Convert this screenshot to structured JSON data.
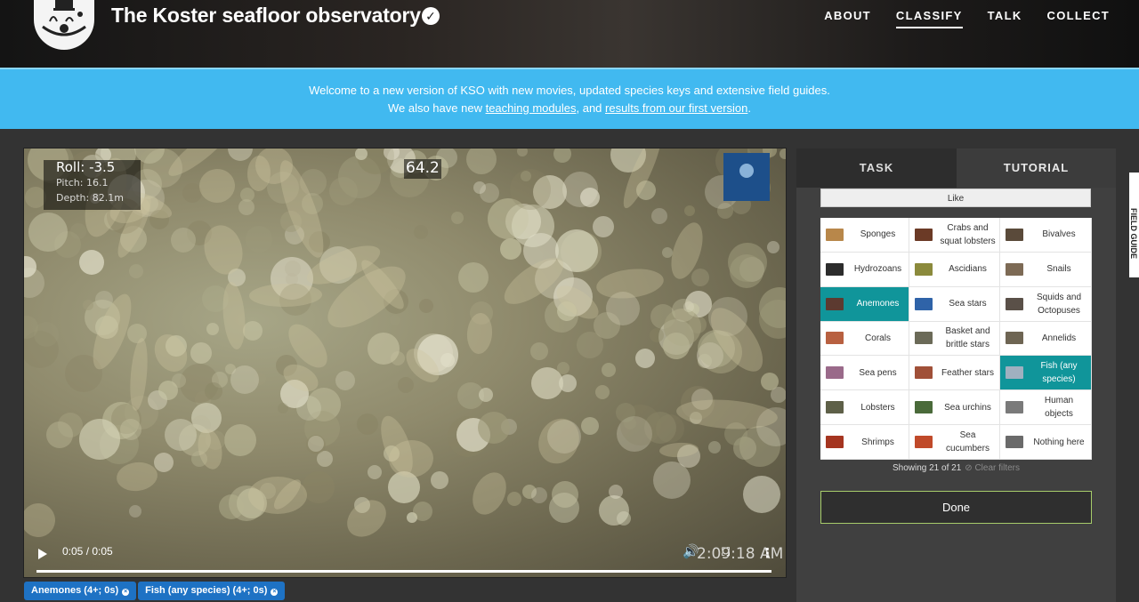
{
  "header": {
    "title": "The Koster seafloor observatory",
    "verified_icon": "check-badge-icon",
    "nav": [
      "ABOUT",
      "CLASSIFY",
      "TALK",
      "COLLECT"
    ],
    "active_nav": "CLASSIFY"
  },
  "banner": {
    "line1": "Welcome to a new version of KSO with new movies, updated species keys and extensive field guides.",
    "line2_prefix": "We also have new ",
    "link1": "teaching modules",
    "line2_mid": ", and ",
    "link2": "results from our first version",
    "line2_suffix": "."
  },
  "video": {
    "overlay_roll": "Roll: -3.5",
    "overlay_pitch": "Pitch: 16.1",
    "overlay_depth": "Depth: 82.1m",
    "overlay_heading": "64.2",
    "time": "0:05 / 0:05",
    "clock": "2:09:18 AM",
    "progress": 1.0
  },
  "tags": [
    {
      "label": "Anemones (4+; 0s)"
    },
    {
      "label": "Fish (any species) (4+; 0s)"
    }
  ],
  "panel": {
    "tab_task": "TASK",
    "tab_tutorial": "TUTORIAL",
    "like": "Like",
    "species": [
      {
        "name": "Sponges",
        "color": "#b8874a"
      },
      {
        "name": "Crabs and squat lobsters",
        "color": "#6b3a26"
      },
      {
        "name": "Bivalves",
        "color": "#5a4a3a"
      },
      {
        "name": "Hydrozoans",
        "color": "#2c2c2c"
      },
      {
        "name": "Ascidians",
        "color": "#8b8a3c"
      },
      {
        "name": "Snails",
        "color": "#7d6a55"
      },
      {
        "name": "Anemones",
        "color": "#5c3a30",
        "selected": true
      },
      {
        "name": "Sea stars",
        "color": "#2f63a8"
      },
      {
        "name": "Squids and Octopuses",
        "color": "#5a5048"
      },
      {
        "name": "Corals",
        "color": "#b86040"
      },
      {
        "name": "Basket and brittle stars",
        "color": "#6b6a58"
      },
      {
        "name": "Annelids",
        "color": "#6e6553"
      },
      {
        "name": "Sea pens",
        "color": "#9a6a8a"
      },
      {
        "name": "Feather stars",
        "color": "#a05038"
      },
      {
        "name": "Fish (any species)",
        "color": "#9fb0c0",
        "selected": true
      },
      {
        "name": "Lobsters",
        "color": "#5e6048"
      },
      {
        "name": "Sea urchins",
        "color": "#4a6a3a"
      },
      {
        "name": "Human objects",
        "color": "#7a7a7a"
      },
      {
        "name": "Shrimps",
        "color": "#a53520"
      },
      {
        "name": "Sea cucumbers",
        "color": "#c04a2a"
      },
      {
        "name": "Nothing here",
        "color": "#6a6a6a"
      }
    ],
    "showing": "Showing 21 of 21",
    "clear_filters": "Clear filters",
    "done": "Done"
  },
  "field_guide": "FIELD GUIDE"
}
